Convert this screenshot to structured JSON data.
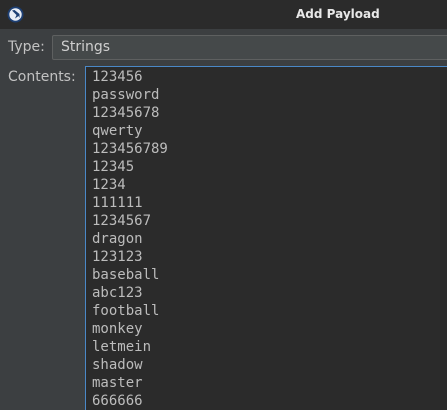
{
  "window": {
    "title": "Add Payload",
    "icon": "app-logo-icon"
  },
  "type_field": {
    "label": "Type:",
    "value": "Strings"
  },
  "contents_field": {
    "label": "Contents:",
    "lines": [
      "123456",
      "password",
      "12345678",
      "qwerty",
      "123456789",
      "12345",
      "1234",
      "111111",
      "1234567",
      "dragon",
      "123123",
      "baseball",
      "abc123",
      "football",
      "monkey",
      "letmein",
      "shadow",
      "master",
      "666666"
    ]
  },
  "colors": {
    "titlebar": "#2b2b2b",
    "background": "#3c3f41",
    "text_area": "#2b2b2b",
    "focus_border": "#4a88c7"
  }
}
